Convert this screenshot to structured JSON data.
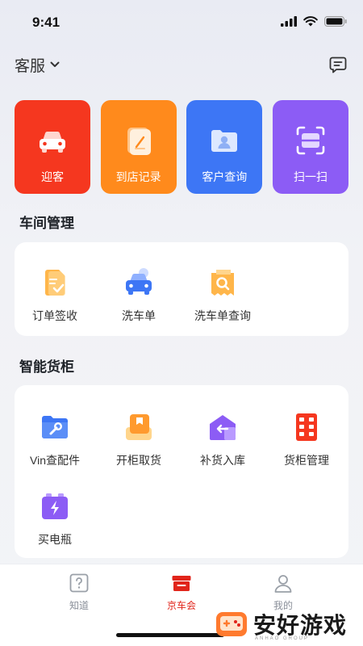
{
  "status_bar": {
    "time": "9:41"
  },
  "header": {
    "title": "客服"
  },
  "quick_actions": [
    {
      "label": "迎客",
      "color": "#f5371f",
      "icon": "car-icon"
    },
    {
      "label": "到店记录",
      "color": "#ff8a1c",
      "icon": "notebook-icon"
    },
    {
      "label": "客户查询",
      "color": "#3d76f5",
      "icon": "customer-folder-icon"
    },
    {
      "label": "扫一扫",
      "color": "#8c5cf5",
      "icon": "scan-icon"
    }
  ],
  "workshop": {
    "title": "车间管理",
    "items": [
      {
        "label": "订单签收",
        "icon": "order-check-icon"
      },
      {
        "label": "洗车单",
        "icon": "car-wash-icon"
      },
      {
        "label": "洗车单查询",
        "icon": "search-ticket-icon"
      }
    ]
  },
  "locker": {
    "title": "智能货柜",
    "items": [
      {
        "label": "Vin查配件",
        "icon": "wrench-folder-icon"
      },
      {
        "label": "开柜取货",
        "icon": "box-icon"
      },
      {
        "label": "补货入库",
        "icon": "warehouse-icon"
      },
      {
        "label": "货柜管理",
        "icon": "cabinet-icon"
      },
      {
        "label": "买电瓶",
        "icon": "battery-icon"
      }
    ]
  },
  "tab_bar": {
    "tabs": [
      {
        "label": "知道",
        "icon": "question-icon"
      },
      {
        "label": "京车会",
        "icon": "store-icon",
        "active": true
      },
      {
        "label": "我的",
        "icon": "user-icon"
      }
    ]
  },
  "watermark": {
    "text": "安好游戏",
    "sub": "ANHAO GROUP"
  }
}
